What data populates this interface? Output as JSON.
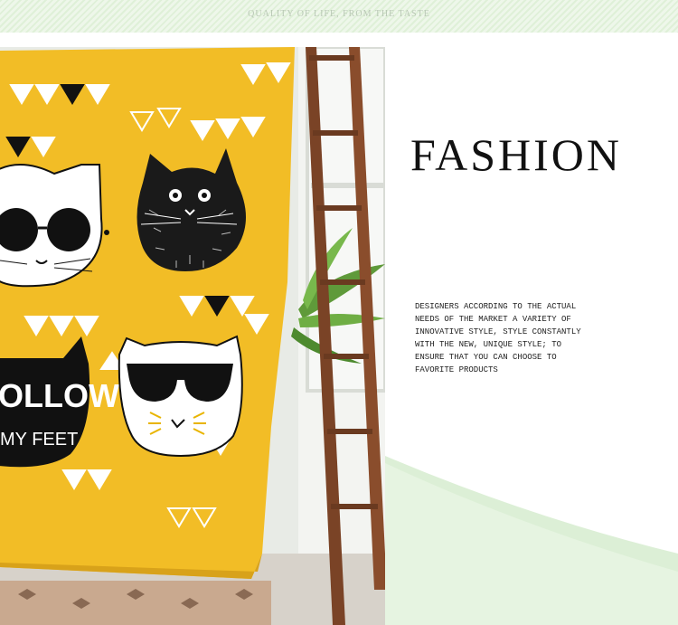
{
  "banner": {
    "tagline": "QUALITY OF LIFE, FROM THE TASTE"
  },
  "feature": {
    "title": "FASHION",
    "description_lines": [
      "DESIGNERS ACCORDING TO THE ACTUAL",
      "NEEDS OF THE MARKET A VARIETY OF",
      "INNOVATIVE STYLE, STYLE CONSTANTLY",
      "WITH THE NEW, UNIQUE STYLE; TO",
      "ENSURE THAT YOU CAN CHOOSE TO",
      "FAVORITE PRODUCTS"
    ]
  },
  "tapestry": {
    "print_text_line1": "OLLOW",
    "print_text_line2": "MY FEET",
    "background_color": "#f2bd26"
  },
  "colors": {
    "top_band": "#e4f2de",
    "panel_wave": "#dcefd6",
    "ladder": "#7a4326"
  }
}
